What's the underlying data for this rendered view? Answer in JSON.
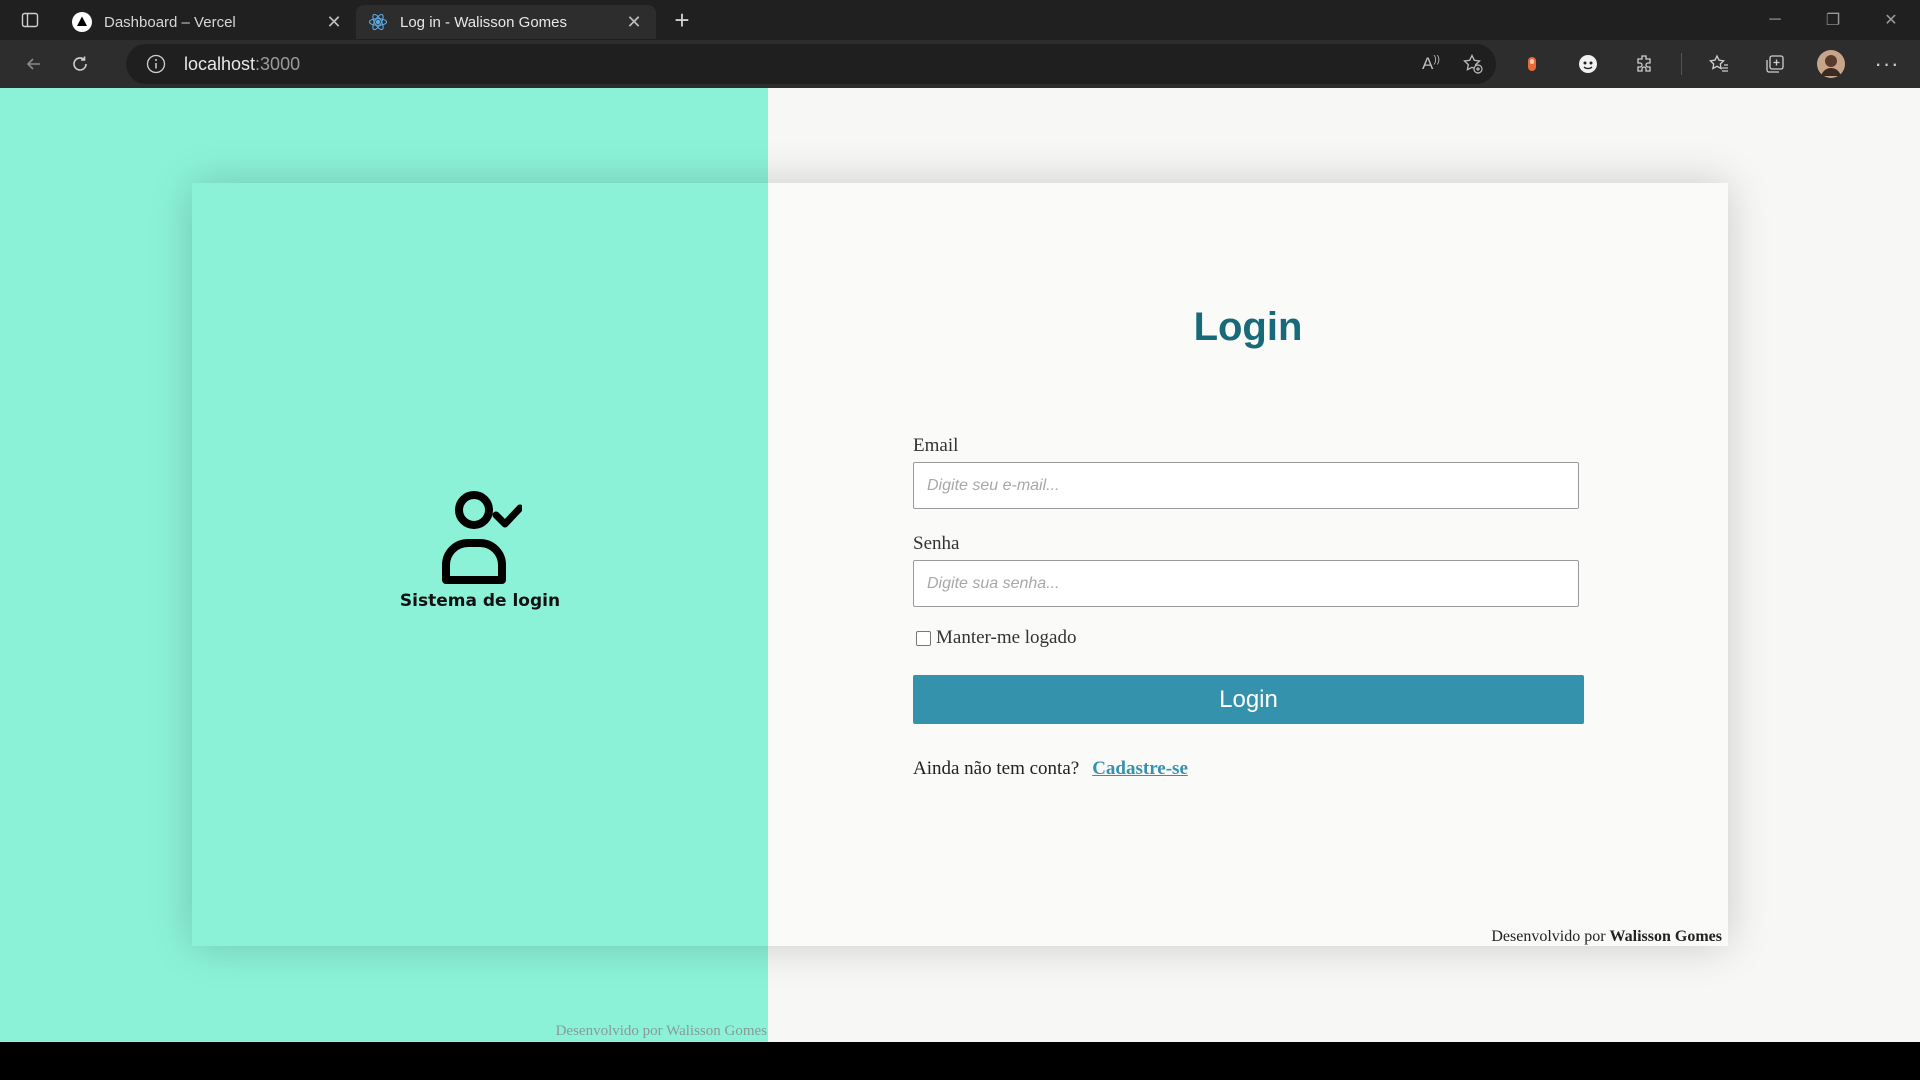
{
  "browser": {
    "tabs": [
      {
        "title": "Dashboard – Vercel",
        "active": false
      },
      {
        "title": "Log in - Walisson Gomes",
        "active": true
      }
    ],
    "url_host": "localhost",
    "url_port": ":3000"
  },
  "page": {
    "brand_name": "Sistema de login",
    "login_title": "Login",
    "email_label": "Email",
    "email_placeholder": "Digite seu e-mail...",
    "password_label": "Senha",
    "password_placeholder": "Digite sua senha...",
    "remember_label": "Manter-me logado",
    "remember_checked": false,
    "login_button": "Login",
    "signup_prompt": "Ainda não tem conta?",
    "signup_link": "Cadastre-se",
    "footer_prefix": "Desenvolvido por",
    "footer_author": "Walisson Gomes",
    "bg_footer": "Desenvolvido por Walisson Gomes"
  },
  "colors": {
    "accent_green": "#8bf2d8",
    "title_teal": "#186a7a",
    "button_blue": "#3592ad"
  },
  "icons": [
    "sidebar-toggle-icon",
    "vercel-logo-icon",
    "react-logo-icon",
    "close-icon",
    "plus-icon",
    "back-icon",
    "reload-icon",
    "info-icon",
    "read-aloud-icon",
    "add-favorite-icon",
    "extension-icon",
    "extensions-icon",
    "favorites-icon",
    "collections-icon",
    "profile-avatar",
    "more-icon",
    "user-check-icon"
  ]
}
